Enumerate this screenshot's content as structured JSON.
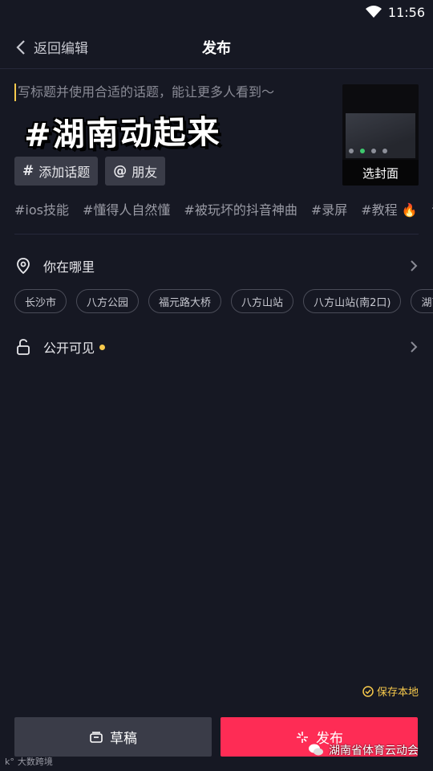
{
  "status": {
    "time": "11:56"
  },
  "nav": {
    "back_label": "返回编辑",
    "title": "发布"
  },
  "caption": {
    "placeholder": "写标题并使用合适的话题，能让更多人看到～",
    "hashtag_overlay": "#湖南动起来"
  },
  "cover": {
    "label": "选封面"
  },
  "chips": {
    "add_topic": "添加话题",
    "topic_symbol": "#",
    "friends": "朋友",
    "friends_symbol": "@"
  },
  "topics": [
    "#ios技能",
    "#懂得人自然懂",
    "#被玩坏的抖音神曲",
    "#录屏",
    "#教程",
    "#"
  ],
  "location": {
    "label": "你在哪里"
  },
  "places": [
    "长沙市",
    "八方公园",
    "福元路大桥",
    "八方山站",
    "八方山站(南2口)",
    "湖南"
  ],
  "visibility": {
    "label": "公开可见"
  },
  "footer": {
    "save_local": "保存本地",
    "draft": "草稿",
    "publish": "发布"
  },
  "watermarks": {
    "left": "大数跨境",
    "right": "湖南省体育云动会"
  },
  "colors": {
    "background": "#161823",
    "accent": "#fe2c55",
    "highlight": "#f7c94c"
  }
}
